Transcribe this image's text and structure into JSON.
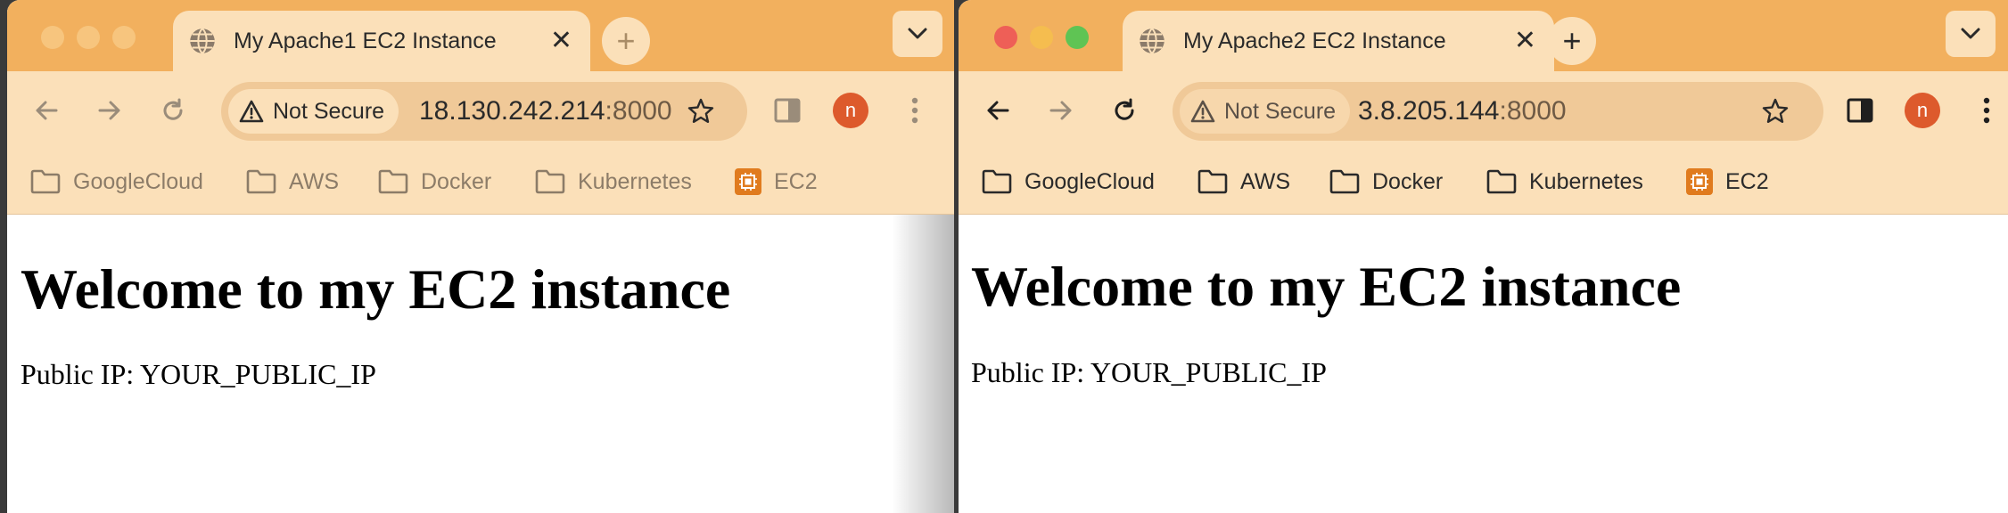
{
  "windows": [
    {
      "tab": {
        "title": "My Apache1 EC2 Instance"
      },
      "omnibox": {
        "security": "Not Secure",
        "host": "18.130.242.214",
        "port": ":8000"
      },
      "avatar": "n",
      "bookmarks": [
        "GoogleCloud",
        "AWS",
        "Docker",
        "Kubernetes",
        "EC2"
      ],
      "page": {
        "heading": "Welcome to my EC2 instance",
        "text": "Public IP: YOUR_PUBLIC_IP"
      },
      "focused": false
    },
    {
      "tab": {
        "title": "My Apache2 EC2 Instance"
      },
      "omnibox": {
        "security": "Not Secure",
        "host": "3.8.205.144",
        "port": ":8000"
      },
      "avatar": "n",
      "bookmarks": [
        "GoogleCloud",
        "AWS",
        "Docker",
        "Kubernetes",
        "EC2"
      ],
      "page": {
        "heading": "Welcome to my EC2 instance",
        "text": "Public IP: YOUR_PUBLIC_IP"
      },
      "focused": true
    }
  ],
  "theme": {
    "tabstrip": "#f2b05e",
    "toolbar": "#fbe0b9",
    "omnibox": "#f0c998",
    "avatar": "#dd5a2c",
    "close_light": "#ee5f57",
    "minimize_light": "#f5bd4f",
    "zoom_light": "#5fc454"
  }
}
